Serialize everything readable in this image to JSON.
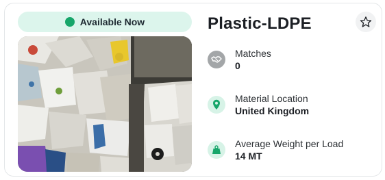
{
  "status": {
    "label": "Available Now",
    "dot_color": "#17a66a"
  },
  "photo": {
    "alt": "",
    "icon": "bale-photo"
  },
  "listing": {
    "title": "Plastic-LDPE"
  },
  "actions": {
    "favorite_icon": "star-icon"
  },
  "details": [
    {
      "label": "Matches",
      "value": "0",
      "icon": "handshake-icon"
    },
    {
      "label": "Material Location",
      "value": "United Kingdom",
      "icon": "location-pin-icon"
    },
    {
      "label": "Average Weight per Load",
      "value": "14 MT",
      "icon": "weight-icon"
    }
  ],
  "colors": {
    "accent_green": "#17a66a",
    "pill_bg": "#dcf5ec",
    "icon_bg_green": "#d7f3e7"
  }
}
